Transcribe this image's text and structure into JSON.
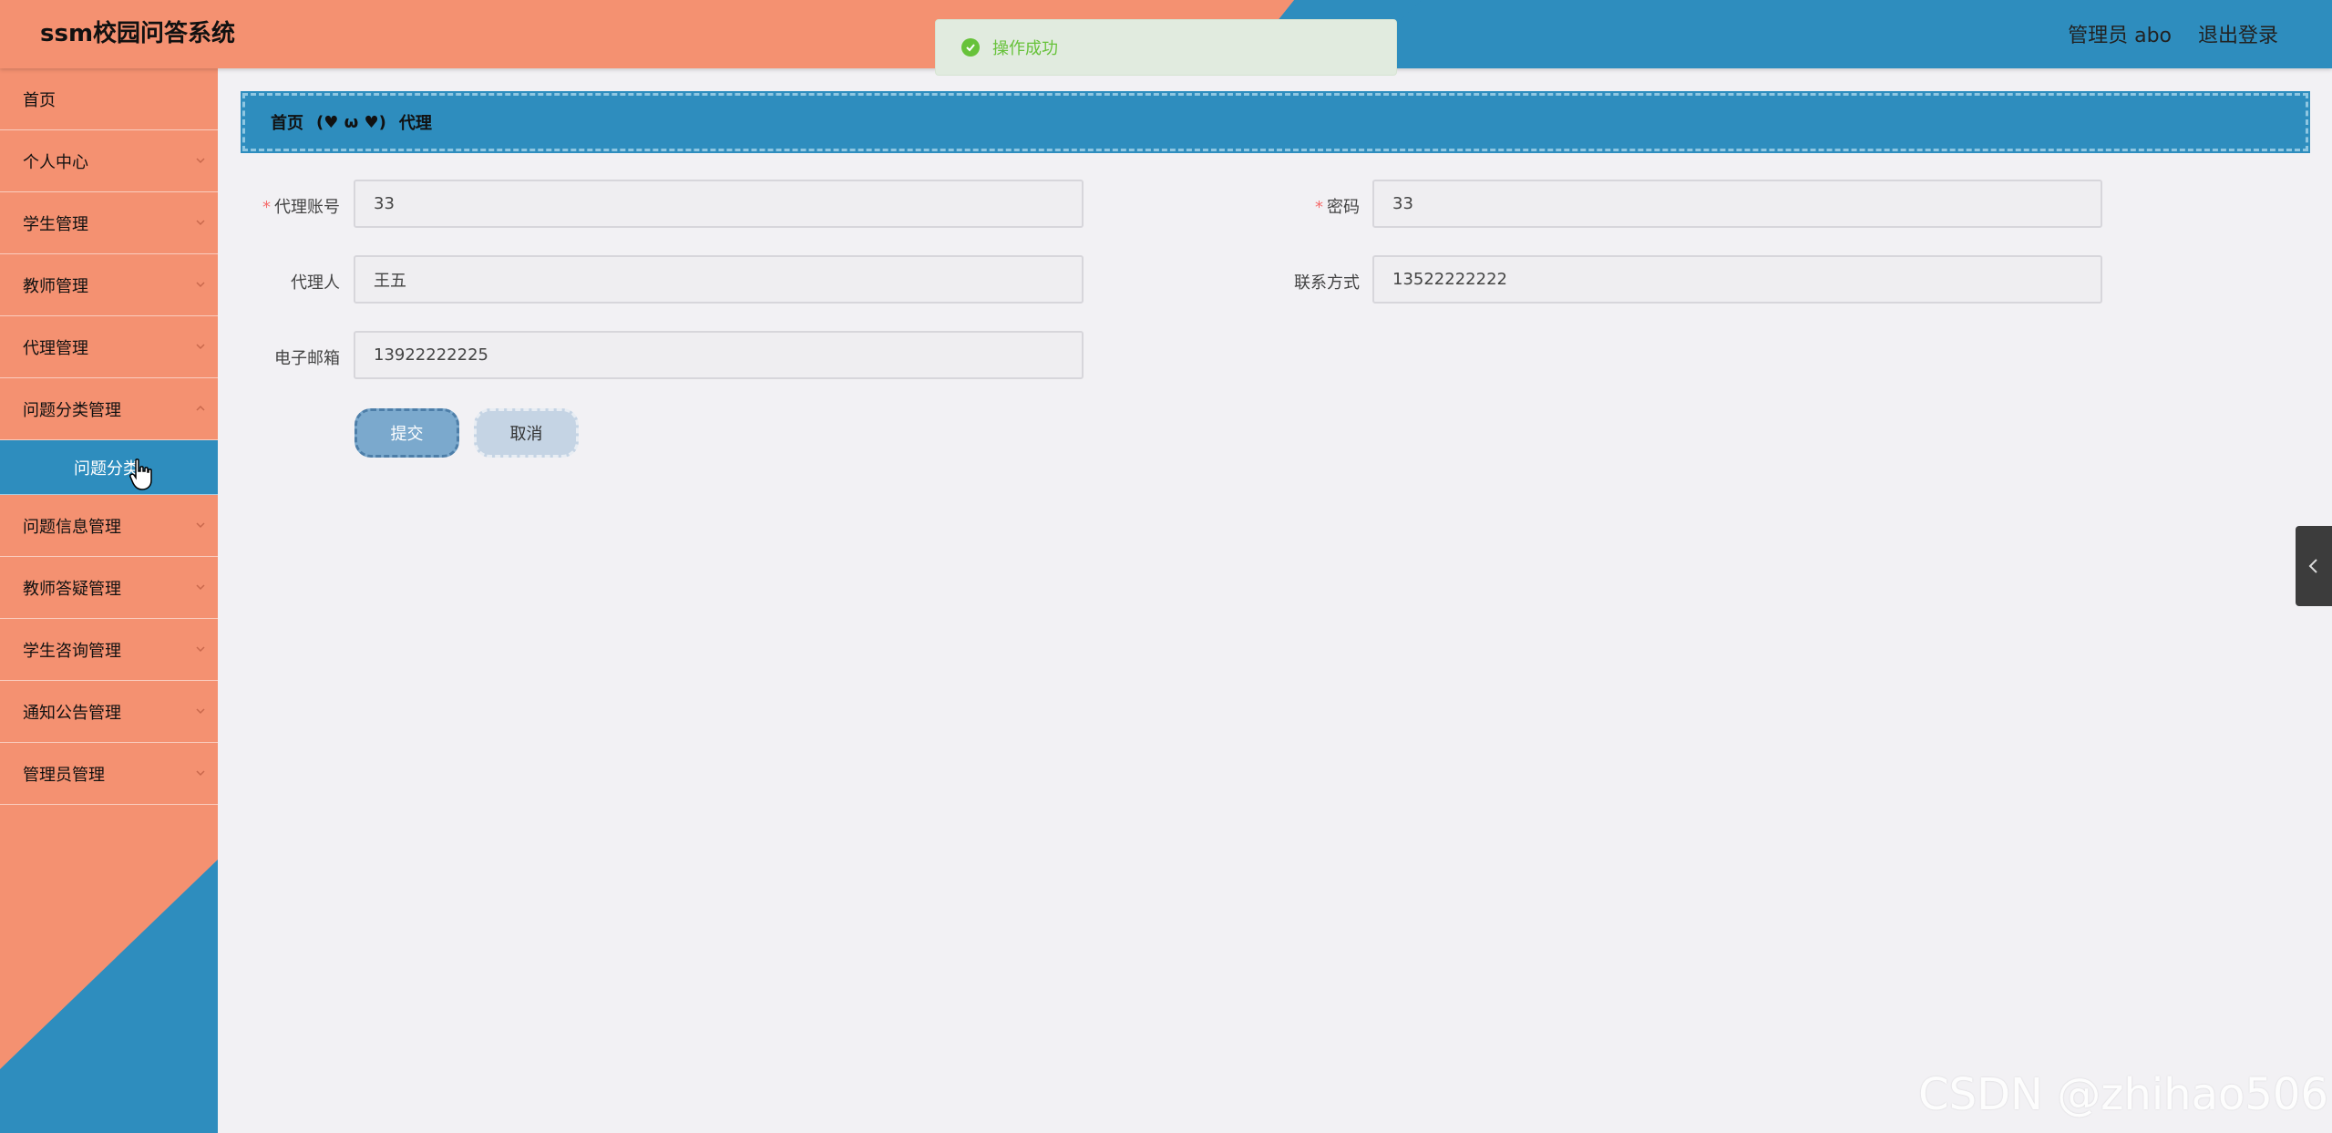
{
  "header": {
    "title": "ssm校园问答系统",
    "user": "管理员 abo",
    "logout_label": "退出登录"
  },
  "toast": {
    "message": "操作成功"
  },
  "sidebar": {
    "items": [
      {
        "label": "首页"
      },
      {
        "label": "个人中心"
      },
      {
        "label": "学生管理"
      },
      {
        "label": "教师管理"
      },
      {
        "label": "代理管理"
      },
      {
        "label": "问题分类管理"
      },
      {
        "label": "问题信息管理"
      },
      {
        "label": "教师答疑管理"
      },
      {
        "label": "学生咨询管理"
      },
      {
        "label": "通知公告管理"
      },
      {
        "label": "管理员管理"
      }
    ],
    "submenu": {
      "label": "问题分类"
    }
  },
  "breadcrumb": {
    "home": "首页",
    "separator": "(♥ ω ♥)",
    "current": "代理"
  },
  "form": {
    "account_label": "代理账号",
    "account_value": "33",
    "password_label": "密码",
    "password_value": "33",
    "name_label": "代理人",
    "name_value": "王五",
    "phone_label": "联系方式",
    "phone_value": "13522222222",
    "email_label": "电子邮箱",
    "email_value": "13922222225",
    "submit_label": "提交",
    "cancel_label": "取消"
  },
  "watermark": "CSDN @zhihao506",
  "colors": {
    "salmon": "#f49171",
    "blue": "#2e8dbe",
    "success": "#67c23a"
  }
}
